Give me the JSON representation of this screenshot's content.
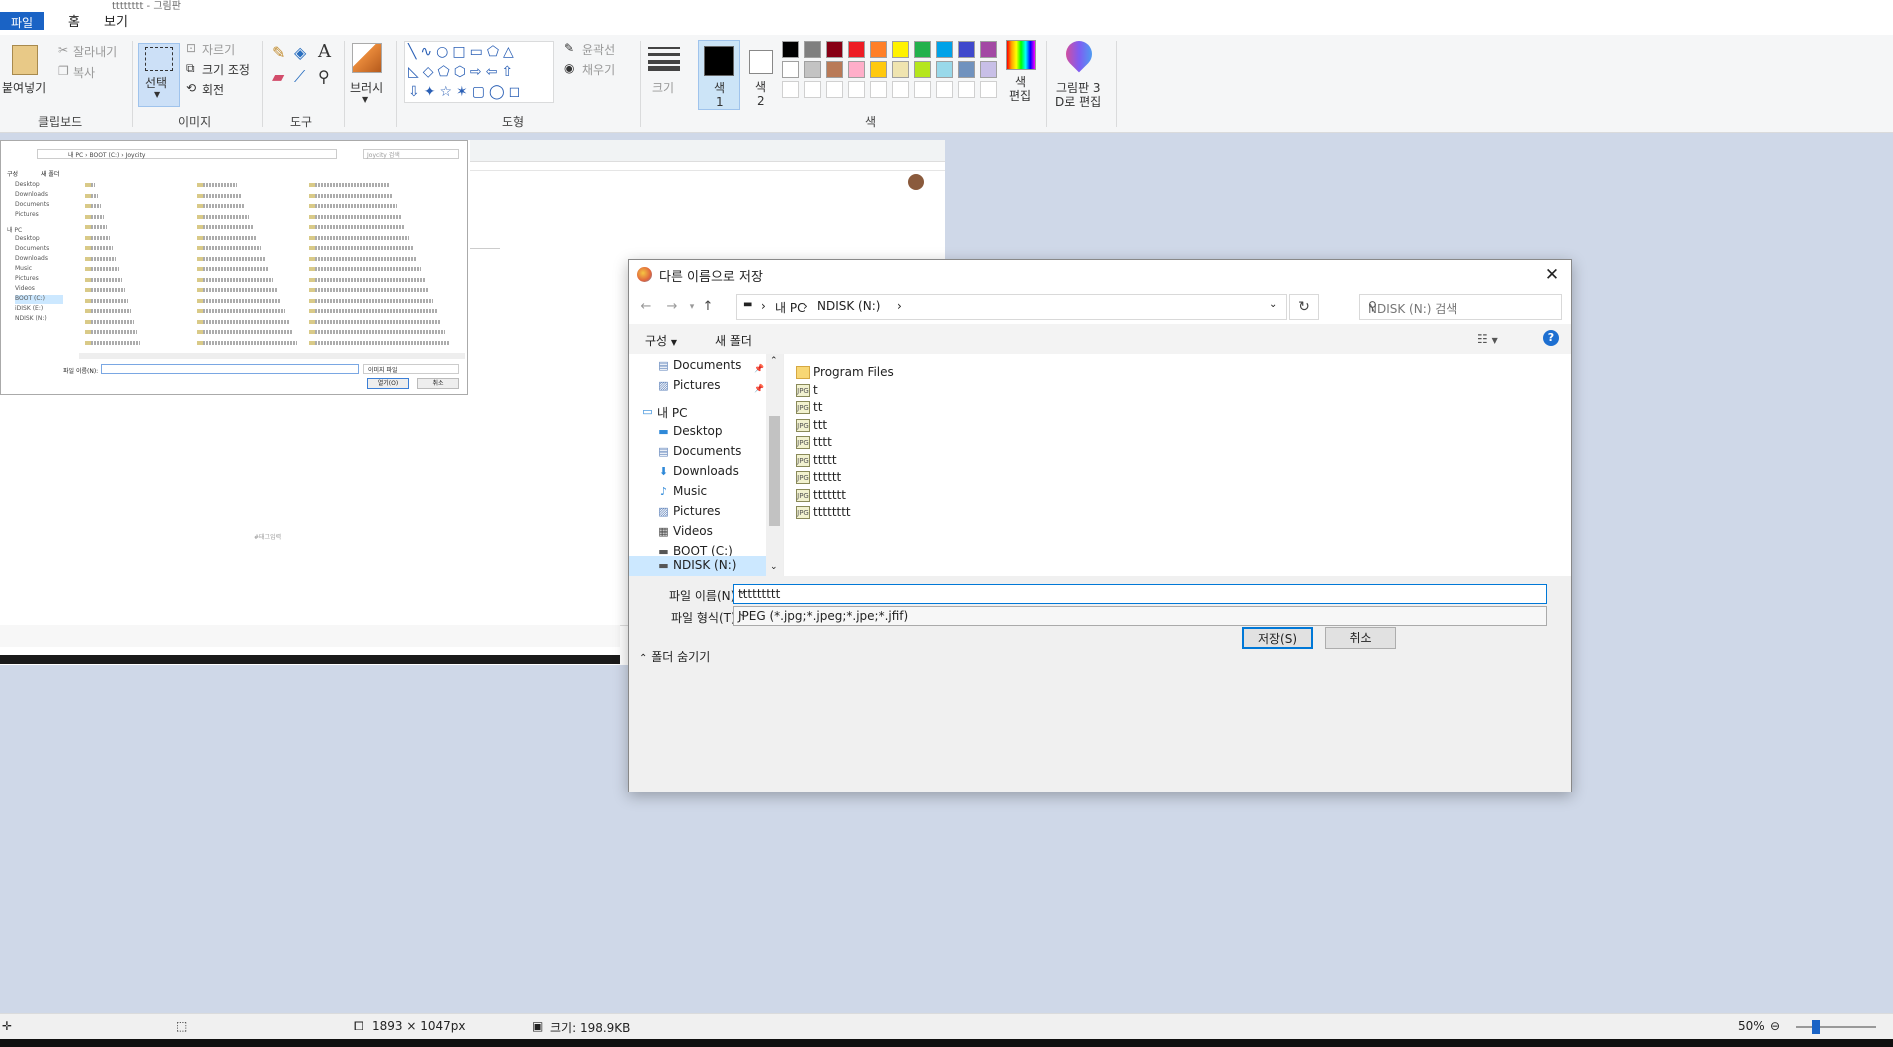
{
  "app": {
    "title_fragment": "tttttttt - 그림판",
    "tabs": [
      "파일",
      "홈",
      "보기"
    ]
  },
  "ribbon": {
    "clipboard": {
      "paste": "붙여넣기",
      "cut": "잘라내기",
      "copy": "복사",
      "group": "클립보드"
    },
    "image": {
      "select": "선택",
      "crop": "자르기",
      "resize": "크기 조정",
      "rotate": "회전",
      "group": "이미지"
    },
    "tools": {
      "group": "도구"
    },
    "brush": {
      "label": "브러시"
    },
    "shapes": {
      "outline": "윤곽선",
      "fill": "채우기",
      "group": "도형"
    },
    "size": {
      "label": "크기"
    },
    "colors": {
      "color1": "색\n1",
      "color1_a": "색",
      "color1_b": "1",
      "color2_a": "색",
      "color2_b": "2",
      "edit_a": "색",
      "edit_b": "편집",
      "paint3d_a": "그림판 3",
      "paint3d_b": "D로 편집",
      "group": "색",
      "palette": [
        "#000000",
        "#7f7f7f",
        "#880015",
        "#ed1c24",
        "#ff7f27",
        "#fff200",
        "#22b14c",
        "#00a2e8",
        "#3f48cc",
        "#a349a4",
        "#ffffff",
        "#c3c3c3",
        "#b97a57",
        "#ffaec9",
        "#ffc90e",
        "#efe4b0",
        "#b5e61d",
        "#99d9ea",
        "#7092be",
        "#c8bfe7"
      ]
    }
  },
  "mini_dialog": {
    "breadcrumb": [
      "내 PC",
      "BOOT (C:)",
      "Joycity"
    ],
    "search_placeholder": "Joycity 검색",
    "organize": "구성",
    "new_folder": "새 폴더",
    "nav": [
      "Desktop",
      "Downloads",
      "Documents",
      "Pictures",
      "내 PC",
      "Desktop",
      "Documents",
      "Downloads",
      "Music",
      "Pictures",
      "Videos",
      "BOOT (C:)",
      "iDISK (E:)",
      "NDISK (N:)"
    ],
    "filename_label": "파일 이름(N):",
    "filetype": "이미지 파일",
    "open": "열기(O)",
    "cancel": "취소",
    "placeholder_text": "#태그입력"
  },
  "dialog": {
    "title": "다른 이름으로 저장",
    "breadcrumb": [
      "내 PC",
      "NDISK (N:)"
    ],
    "search_placeholder": "NDISK (N:) 검색",
    "toolbar": {
      "organize": "구성",
      "new_folder": "새 폴더"
    },
    "nav_items": [
      {
        "label": "Documents",
        "icon": "documents-icon",
        "pin": true
      },
      {
        "label": "Pictures",
        "icon": "pictures-icon",
        "pin": true
      },
      {
        "label": "내 PC",
        "icon": "this-pc-icon",
        "pin": false
      },
      {
        "label": "Desktop",
        "icon": "desktop-icon",
        "pin": false
      },
      {
        "label": "Documents",
        "icon": "documents-icon",
        "pin": false
      },
      {
        "label": "Downloads",
        "icon": "downloads-icon",
        "pin": false
      },
      {
        "label": "Music",
        "icon": "music-icon",
        "pin": false
      },
      {
        "label": "Pictures",
        "icon": "pictures-icon",
        "pin": false
      },
      {
        "label": "Videos",
        "icon": "videos-icon",
        "pin": false
      },
      {
        "label": "BOOT (C:)",
        "icon": "drive-icon",
        "pin": false
      },
      {
        "label": "iDISK (E:)",
        "icon": "drive-icon",
        "pin": false
      },
      {
        "label": "NDISK (N:)",
        "icon": "drive-icon",
        "pin": false
      }
    ],
    "files": [
      {
        "name": "Program Files",
        "type": "folder"
      },
      {
        "name": "t",
        "type": "jpg"
      },
      {
        "name": "tt",
        "type": "jpg"
      },
      {
        "name": "ttt",
        "type": "jpg"
      },
      {
        "name": "tttt",
        "type": "jpg"
      },
      {
        "name": "ttttt",
        "type": "jpg"
      },
      {
        "name": "tttttt",
        "type": "jpg"
      },
      {
        "name": "ttttttt",
        "type": "jpg"
      },
      {
        "name": "tttttttt",
        "type": "jpg"
      }
    ],
    "filename_label": "파일 이름(N):",
    "filename_value": "ttttttttt",
    "filetype_label": "파일 형식(T):",
    "filetype_value": "JPEG (*.jpg;*.jpeg;*.jpe;*.jfif)",
    "hide_folders": "폴더 숨기기",
    "save": "저장(S)",
    "cancel": "취소"
  },
  "statusbar": {
    "dimensions": "1893 × 1047px",
    "size": "크기: 198.9KB",
    "zoom": "50%"
  },
  "colors": {
    "accent": "#1a63c5",
    "focus": "#0078d7",
    "canvas_bg": "#cfd8e8"
  }
}
